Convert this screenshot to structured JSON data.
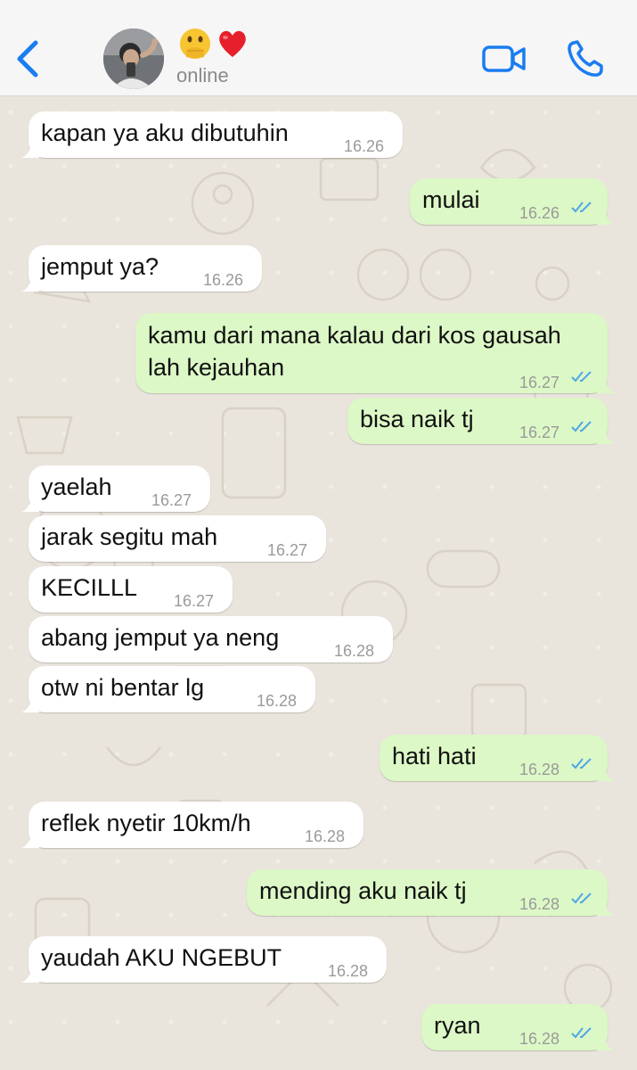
{
  "header": {
    "status": "online",
    "emoji_1": "🫢",
    "emoji_2": "❤️"
  },
  "messages": [
    {
      "dir": "in",
      "text": "kapan ya aku dibutuhin",
      "time": "16.26"
    },
    {
      "dir": "out",
      "text": "mulai",
      "time": "16.26",
      "read": true
    },
    {
      "dir": "in",
      "text": "jemput ya?",
      "time": "16.26"
    },
    {
      "dir": "out",
      "text": "kamu dari mana kalau dari kos gausah\nlah kejauhan",
      "time": "16.27",
      "read": true
    },
    {
      "dir": "out",
      "text": "bisa naik tj",
      "time": "16.27",
      "read": true
    },
    {
      "dir": "in",
      "text": "yaelah",
      "time": "16.27"
    },
    {
      "dir": "in",
      "text": "jarak segitu mah",
      "time": "16.27"
    },
    {
      "dir": "in",
      "text": "KECILLL",
      "time": "16.27"
    },
    {
      "dir": "in",
      "text": "abang jemput ya neng",
      "time": "16.28"
    },
    {
      "dir": "in",
      "text": "otw ni bentar lg",
      "time": "16.28"
    },
    {
      "dir": "out",
      "text": "hati hati",
      "time": "16.28",
      "read": true
    },
    {
      "dir": "in",
      "text": "reflek nyetir 10km/h",
      "time": "16.28"
    },
    {
      "dir": "out",
      "text": "mending aku naik tj",
      "time": "16.28",
      "read": true
    },
    {
      "dir": "in",
      "text": "yaudah AKU NGEBUT",
      "time": "16.28"
    },
    {
      "dir": "out",
      "text": "ryan",
      "time": "16.28",
      "read": true
    }
  ],
  "colors": {
    "accent": "#1a7cf0",
    "outgoing_bubble": "#dcf8c6",
    "incoming_bubble": "#ffffff",
    "chat_background": "#e9e4dc",
    "read_ticks": "#4fa6e8"
  },
  "icons": [
    "chevron-left-icon",
    "video-camera-icon",
    "phone-icon",
    "double-check-icon"
  ]
}
